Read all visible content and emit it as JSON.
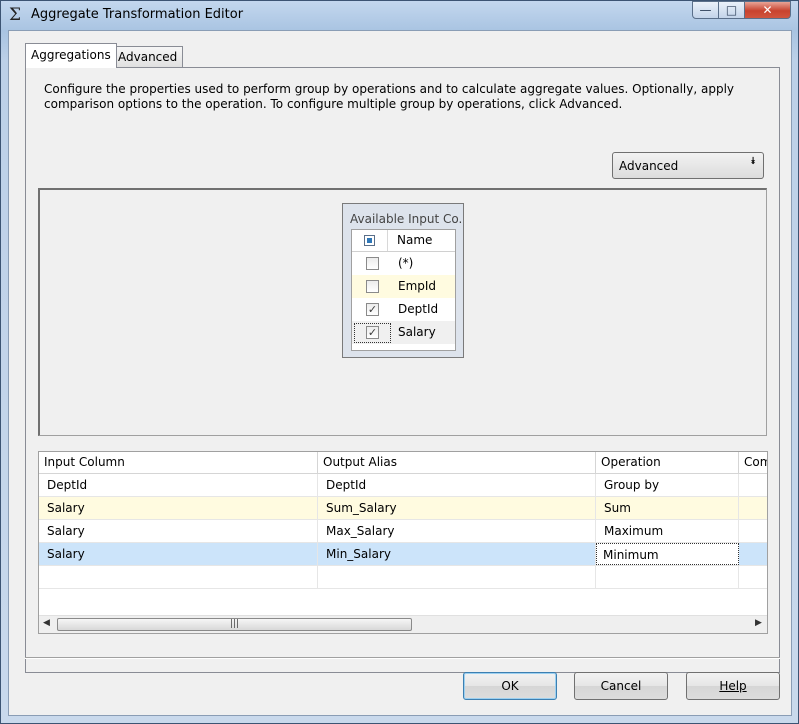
{
  "window": {
    "title": "Aggregate Transformation Editor",
    "title_icon": "Σ",
    "controls": {
      "minimize": "—",
      "maximize": "□",
      "close": "✕"
    }
  },
  "tabs": [
    {
      "label": "Aggregations",
      "active": true
    },
    {
      "label": "Advanced",
      "active": false
    }
  ],
  "description": "Configure the properties used to perform group by operations and to calculate aggregate values. Optionally, apply comparison options to the operation. To configure multiple group by operations, click Advanced.",
  "advanced_combo": {
    "label": "Advanced",
    "arrow_icon": "double-chevron-down-icon",
    "arrow_glyph": "⯯"
  },
  "available_columns": {
    "title": "Available Input Co...",
    "header": "Name",
    "items": [
      {
        "name": "(*)",
        "checked": false
      },
      {
        "name": "EmpId",
        "checked": false
      },
      {
        "name": "DeptId",
        "checked": true
      },
      {
        "name": "Salary",
        "checked": true
      }
    ]
  },
  "grid": {
    "columns": [
      "Input Column",
      "Output Alias",
      "Operation",
      "Com"
    ],
    "rows": [
      {
        "input": "DeptId",
        "alias": "DeptId",
        "operation": "Group by"
      },
      {
        "input": "Salary",
        "alias": "Sum_Salary",
        "operation": "Sum"
      },
      {
        "input": "Salary",
        "alias": "Max_Salary",
        "operation": "Maximum"
      },
      {
        "input": "Salary",
        "alias": "Min_Salary",
        "operation": "Minimum"
      }
    ],
    "scroll_left": "◀",
    "scroll_right": "▶",
    "thumb_grip": "|||"
  },
  "buttons": {
    "ok": "OK",
    "cancel": "Cancel",
    "help": "Help"
  },
  "colors": {
    "selected_row": "#cce4fa",
    "highlight_row": "#fffbe0",
    "close_button": "#c8432f"
  }
}
